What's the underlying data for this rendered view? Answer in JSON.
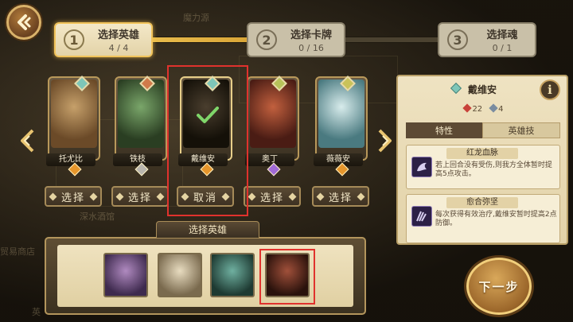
{
  "steps": [
    {
      "num": "1",
      "title": "选择英雄",
      "count": "4 / 4",
      "state": "active"
    },
    {
      "num": "2",
      "title": "选择卡牌",
      "count": "0 / 16",
      "state": "pending"
    },
    {
      "num": "3",
      "title": "选择魂",
      "count": "0 / 1",
      "state": "pending"
    }
  ],
  "heroes": [
    {
      "name": "托尤比",
      "button": "选择",
      "gem_color": "#7ec6b8",
      "badge_color": "#e6962c",
      "art_color": "#8a6a42"
    },
    {
      "name": "铁枝",
      "button": "选择",
      "gem_color": "#d07a4a",
      "badge_color": "#b9b6ae",
      "art_color": "#4a6a3a"
    },
    {
      "name": "戴维安",
      "button": "取消",
      "gem_color": "#7ec6b8",
      "badge_color": "#e6962c",
      "art_color": "#2e2a22",
      "selected": true
    },
    {
      "name": "奥丁",
      "button": "选择",
      "gem_color": "#b7c25a",
      "badge_color": "#a06ad6",
      "art_color": "#8a3a2a"
    },
    {
      "name": "薇薇安",
      "button": "选择",
      "gem_color": "#c9c25a",
      "badge_color": "#e6962c",
      "art_color": "#6a9aa0"
    }
  ],
  "info": {
    "hero_name": "戴维安",
    "hp": "22",
    "attack": "4",
    "info_button": "i",
    "tabs": [
      {
        "label": "特性",
        "active": true
      },
      {
        "label": "英雄技",
        "active": false
      }
    ],
    "skills": [
      {
        "title": "红龙血脉",
        "desc": "若上回合没有受伤,则我方全体暂时提高5点攻击。"
      },
      {
        "title": "愈合弥坚",
        "desc": "每次获得有效治疗,戴维安暂时提高2点防御。"
      }
    ]
  },
  "tray": {
    "label": "选择英雄",
    "portraits": [
      {
        "name": "hero-portrait-1",
        "color": "#6a4a7a"
      },
      {
        "name": "hero-portrait-2",
        "color": "#b8a88a"
      },
      {
        "name": "hero-portrait-3",
        "color": "#3a6a5a"
      },
      {
        "name": "hero-portrait-4",
        "color": "#5a2a22"
      }
    ]
  },
  "next_button": "下一步",
  "background_text": [
    "深水酒馆",
    "贸易商店",
    "魔力源",
    "英"
  ]
}
